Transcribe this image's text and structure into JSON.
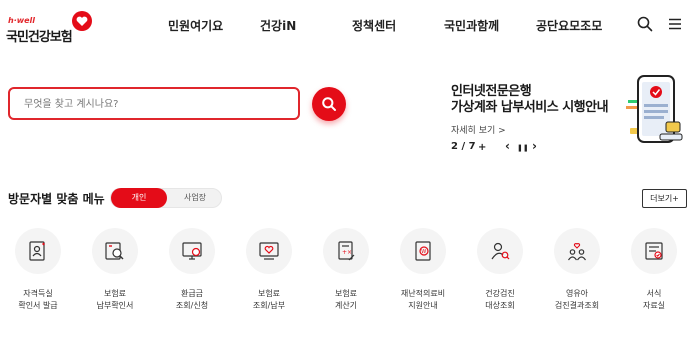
{
  "logo": {
    "small": "h·well",
    "main": "국민건강보험"
  },
  "nav": {
    "items": [
      "민원여기요",
      "건강iN",
      "정책센터",
      "국민과함께",
      "공단요모조모"
    ]
  },
  "icons": {
    "search": "search-icon",
    "menu": "hamburger-menu-icon"
  },
  "search": {
    "placeholder": "무엇을 찾고 계시나요?",
    "value": ""
  },
  "banner": {
    "title_line1": "인터넷전문은행",
    "title_line2": "가상계좌 납부서비스 시행안내",
    "more": "자세히 보기 >",
    "pager": "2 / 7",
    "plus": "+",
    "prev": "‹",
    "pause": "❚❚",
    "next": "›"
  },
  "menu": {
    "title": "방문자별 맞춤 메뉴",
    "tab_personal": "개인",
    "tab_business": "사업장",
    "more": "더보기+",
    "items": [
      {
        "line1": "자격득실",
        "line2": "확인서 발급",
        "icon": "certificate-person-icon"
      },
      {
        "line1": "보험료",
        "line2": "납부확인서",
        "icon": "document-search-icon"
      },
      {
        "line1": "환급금",
        "line2": "조회/신청",
        "icon": "monitor-won-icon"
      },
      {
        "line1": "보험료",
        "line2": "조회/납부",
        "icon": "monitor-heart-icon"
      },
      {
        "line1": "보험료",
        "line2": "계산기",
        "icon": "calculator-hand-icon"
      },
      {
        "line1": "재난적의료비",
        "line2": "지원안내",
        "icon": "door-won-icon"
      },
      {
        "line1": "건강검진",
        "line2": "대상조회",
        "icon": "person-search-icon"
      },
      {
        "line1": "영유아",
        "line2": "검진결과조회",
        "icon": "family-heart-icon"
      },
      {
        "line1": "서식",
        "line2": "자료실",
        "icon": "form-document-icon"
      }
    ]
  },
  "colors": {
    "brand_red": "#e40c18",
    "icon_circle": "#f4f4f4"
  }
}
